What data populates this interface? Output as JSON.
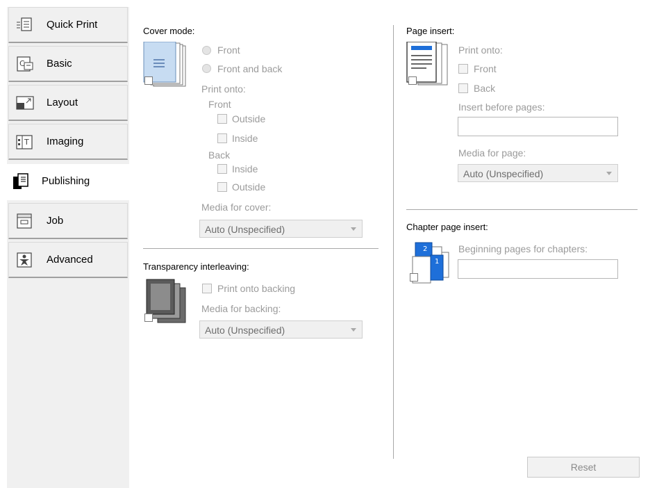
{
  "sidebar": {
    "tabs": [
      {
        "label": "Quick Print",
        "icon": "quick-print-icon"
      },
      {
        "label": "Basic",
        "icon": "basic-icon"
      },
      {
        "label": "Layout",
        "icon": "layout-icon"
      },
      {
        "label": "Imaging",
        "icon": "imaging-icon"
      },
      {
        "label": "Publishing",
        "icon": "publishing-icon",
        "active": true
      },
      {
        "label": "Job",
        "icon": "job-icon"
      },
      {
        "label": "Advanced",
        "icon": "advanced-icon"
      }
    ]
  },
  "cover_mode": {
    "heading": "Cover mode:",
    "radio_front": "Front",
    "radio_front_back": "Front and back",
    "print_onto": "Print onto:",
    "front_group": "Front",
    "front_outside": "Outside",
    "front_inside": "Inside",
    "back_group": "Back",
    "back_inside": "Inside",
    "back_outside": "Outside",
    "media_label": "Media for cover:",
    "media_value": "Auto (Unspecified)"
  },
  "transparency": {
    "heading": "Transparency interleaving:",
    "print_onto_backing": "Print onto backing",
    "media_label": "Media for backing:",
    "media_value": "Auto (Unspecified)"
  },
  "page_insert": {
    "heading": "Page insert:",
    "print_onto": "Print onto:",
    "front": "Front",
    "back": "Back",
    "insert_before_label": "Insert before pages:",
    "insert_before_value": "",
    "media_label": "Media for page:",
    "media_value": "Auto (Unspecified)"
  },
  "chapter_insert": {
    "heading": "Chapter page insert:",
    "beginning_label": "Beginning pages for chapters:",
    "beginning_value": ""
  },
  "footer": {
    "reset_label": "Reset"
  },
  "colors": {
    "accent_blue": "#1e6fd9",
    "disabled_text": "#9b9b9b",
    "panel_bg": "#f0f0f0"
  }
}
